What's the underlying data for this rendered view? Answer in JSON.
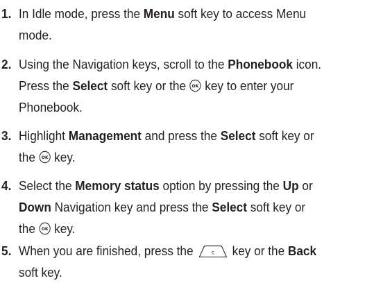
{
  "steps": [
    {
      "number": "1.",
      "line1": {
        "t1": "In Idle mode, press the ",
        "b1": "Menu",
        "t2": " soft key to access Menu"
      },
      "line2": {
        "t1": "mode."
      }
    },
    {
      "number": "2.",
      "line1": {
        "t1": "Using the Navigation keys, scroll to the ",
        "b1": "Phonebook",
        "t2": " icon."
      },
      "line2": {
        "t1": "Press the ",
        "b1": "Select",
        "t2": " soft key or the ",
        "t3": " key to enter your"
      },
      "line3": {
        "t1": "Phonebook."
      }
    },
    {
      "number": "3.",
      "line1": {
        "t1": "Highlight ",
        "b1": "Management",
        "t2": " and press the ",
        "b2": "Select",
        "t3": " soft key or"
      },
      "line2": {
        "t1": "the ",
        "t2": " key."
      }
    },
    {
      "number": "4.",
      "line1": {
        "t1": "Select the ",
        "b1": "Memory status",
        "t2": " option by pressing the ",
        "b2": "Up",
        "t3": " or"
      },
      "line2": {
        "b1": "Down",
        "t1": " Navigation key and press the ",
        "b2": "Select",
        "t2": " soft key or"
      },
      "line3": {
        "t1": "the ",
        "t2": " key."
      }
    },
    {
      "number": "5.",
      "line1": {
        "t1": "When you are finished, press the ",
        "t2": " key or the ",
        "b1": "Back"
      },
      "line2": {
        "t1": "soft key."
      }
    }
  ],
  "icons": {
    "ok_key": "ok-key-icon",
    "end_key": "end-key-icon",
    "ok_key_glyph_text": "OK",
    "end_key_glyph_text": "c"
  }
}
